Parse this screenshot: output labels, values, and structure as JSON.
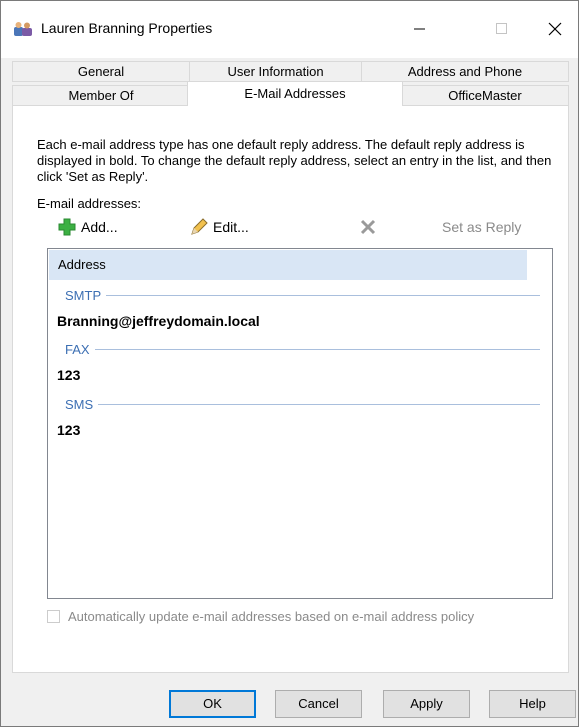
{
  "window": {
    "title": "Lauren Branning Properties"
  },
  "tabs": {
    "row1": [
      {
        "label": "General"
      },
      {
        "label": "User Information"
      },
      {
        "label": "Address and Phone"
      }
    ],
    "row2": [
      {
        "label": "Member Of"
      },
      {
        "label": "E-Mail Addresses",
        "active": true
      },
      {
        "label": "OfficeMaster"
      }
    ]
  },
  "content": {
    "description": "Each e-mail address type has one default reply address. The default reply address is displayed in bold. To change the default reply address, select an entry in the list, and then click 'Set as Reply'.",
    "email_label": "E-mail addresses:",
    "toolbar": {
      "add_label": "Add...",
      "edit_label": "Edit...",
      "set_reply_label": "Set as Reply"
    },
    "list": {
      "header": "Address",
      "groups": [
        {
          "type": "SMTP",
          "entry": "Branning@jeffreydomain.local"
        },
        {
          "type": "FAX",
          "entry": "123"
        },
        {
          "type": "SMS",
          "entry": "123"
        }
      ]
    },
    "auto_update_label": "Automatically update e-mail addresses based on e-mail address policy"
  },
  "buttons": {
    "ok": "OK",
    "cancel": "Cancel",
    "apply": "Apply",
    "help": "Help"
  },
  "colors": {
    "header_bg": "#d9e6f5",
    "group_text": "#3c6fb3",
    "add_icon": "#3cb043",
    "default_button_border": "#0078d7"
  },
  "icons": {
    "title": "users-icon",
    "add": "plus-icon",
    "edit": "pencil-icon",
    "remove": "x-icon"
  }
}
